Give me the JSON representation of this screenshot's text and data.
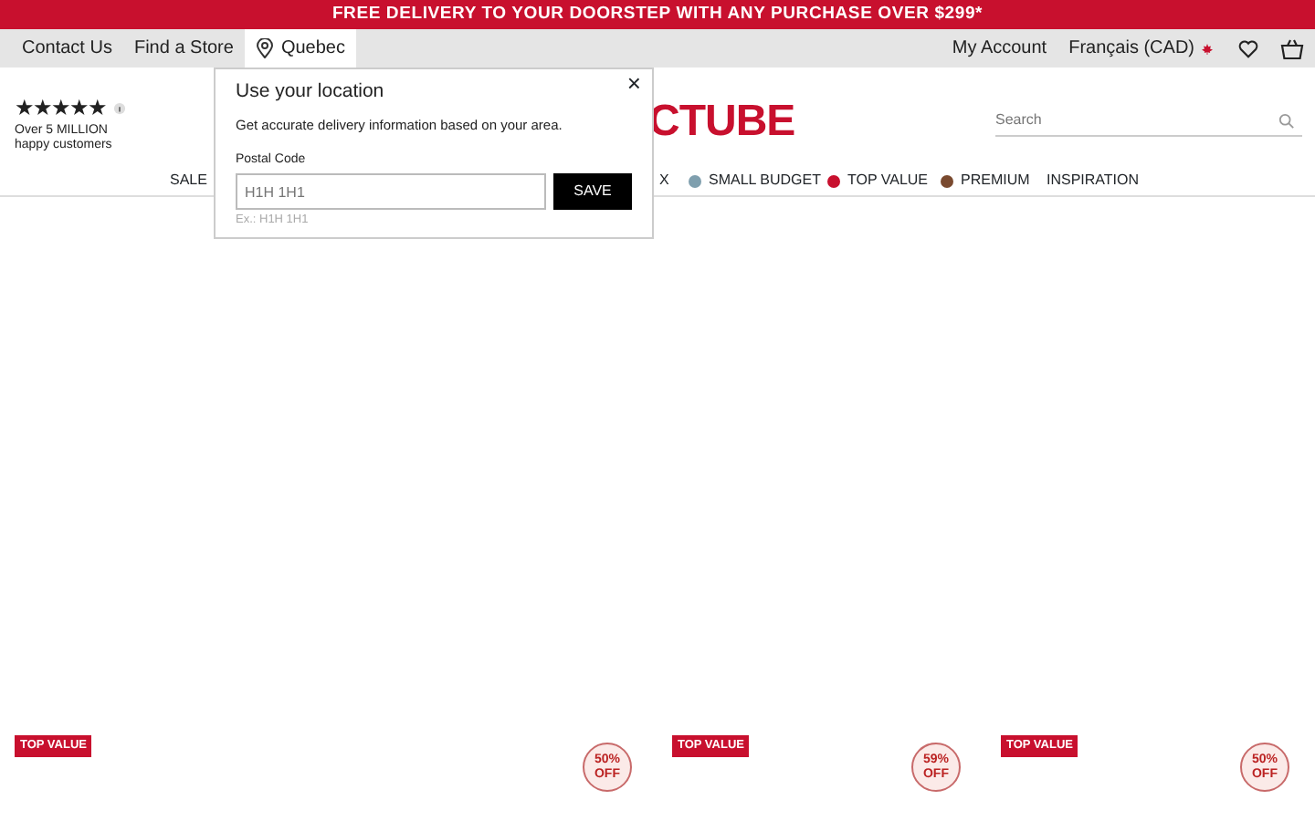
{
  "promo_banner": "FREE DELIVERY TO YOUR DOORSTEP WITH ANY PURCHASE OVER $299*",
  "utility_bar": {
    "left_links": [
      {
        "label": "Contact Us",
        "kind": "link"
      },
      {
        "label": "Find a Store",
        "kind": "link"
      },
      {
        "label": "Quebec",
        "kind": "location",
        "selected": true
      }
    ],
    "right_links": [
      {
        "label": "My Account",
        "kind": "link"
      },
      {
        "label": "Français (CAD)",
        "kind": "language"
      }
    ]
  },
  "rating": {
    "stars": 5,
    "line_1": "Over 5 MILLION",
    "line_2": "happy customers"
  },
  "logo": "CTUBE",
  "search": {
    "placeholder": "Search"
  },
  "nav": [
    {
      "label": "SALE"
    },
    {
      "label": "X"
    },
    {
      "label": "SMALL BUDGET",
      "color": "#7f9fae"
    },
    {
      "label": "TOP VALUE",
      "color": "#c8102e"
    },
    {
      "label": "PREMIUM",
      "color": "#7a4a2f"
    },
    {
      "label": "INSPIRATION"
    }
  ],
  "location_popover": {
    "title": "Use your location",
    "description": "Get accurate delivery information based on your area.",
    "field_label": "Postal Code",
    "placeholder": "H1H 1H1",
    "hint": "Ex.: H1H 1H1",
    "button": "SAVE",
    "close": "×"
  },
  "products": [
    {
      "badge": "TOP VALUE"
    },
    {
      "discount": "50%\nOFF"
    },
    {
      "badge": "TOP VALUE",
      "discount": "59%\nOFF"
    },
    {
      "badge": "TOP VALUE",
      "discount": "50%\nOFF"
    }
  ]
}
